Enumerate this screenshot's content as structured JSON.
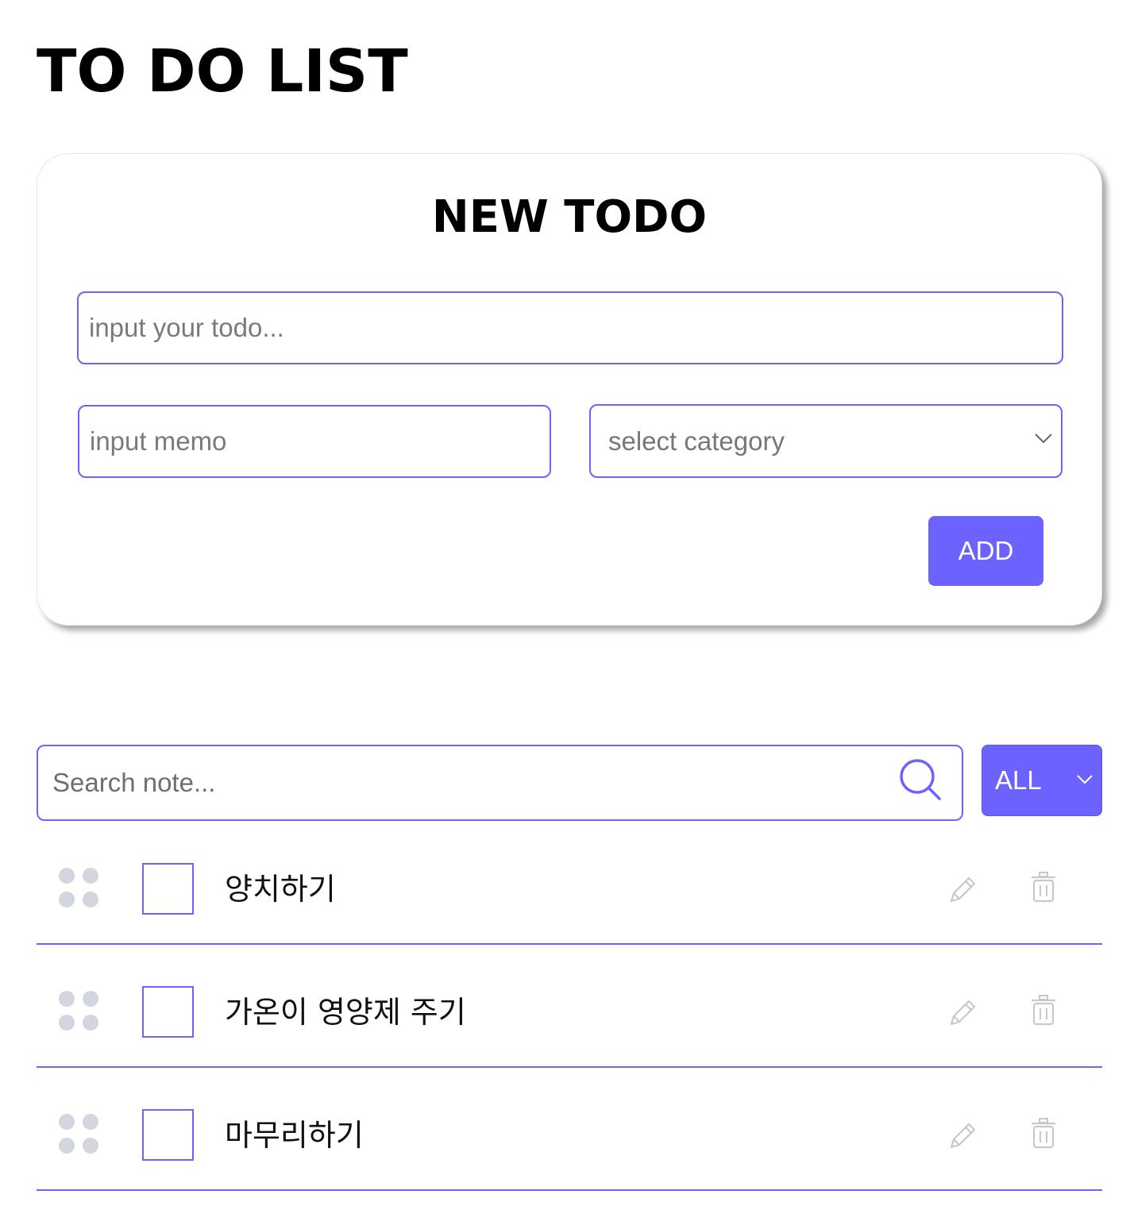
{
  "header": {
    "title": "TO DO LIST"
  },
  "new_todo": {
    "title": "NEW TODO",
    "todo_placeholder": "input your todo...",
    "memo_placeholder": "input memo",
    "category_selected": "select category",
    "add_label": "ADD"
  },
  "search": {
    "placeholder": "Search note...",
    "filter_selected": "ALL"
  },
  "todos": [
    {
      "text": "양치하기",
      "checked": false
    },
    {
      "text": "가온이 영양제 주기",
      "checked": false
    },
    {
      "text": "마무리하기",
      "checked": false
    }
  ],
  "colors": {
    "accent": "#6c63ff",
    "handle_dots": "#d3d6de",
    "icon_muted": "#c8c8c8"
  },
  "icons": {
    "select": "chevron-down-icon",
    "search": "search-icon",
    "drag": "drag-handle-icon",
    "edit": "pencil-icon",
    "delete": "trash-icon"
  }
}
